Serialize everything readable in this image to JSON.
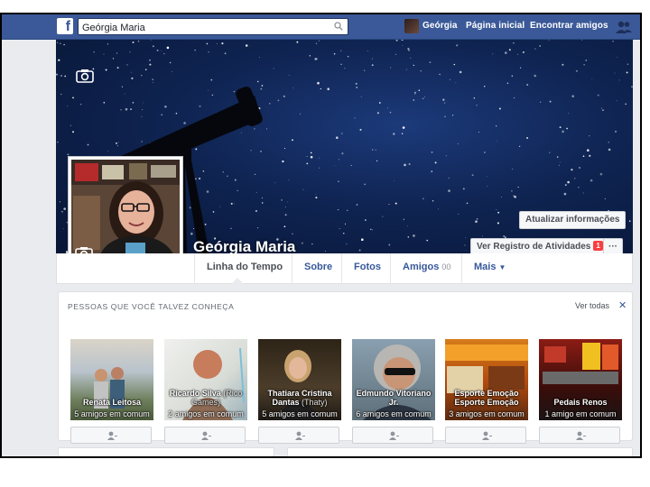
{
  "topbar": {
    "logo": "f",
    "search_value": "Geórgia Maria",
    "user_name": "Geórgia",
    "home_label": "Página inicial",
    "find_friends_label": "Encontrar amigos",
    "icons": [
      "facebook-logo",
      "search-icon",
      "friends-icon"
    ]
  },
  "profile": {
    "name": "Geórgia Maria",
    "update_info_label": "Atualizar informações",
    "activity_log_label": "Ver Registro de Atividades",
    "activity_badge": "1",
    "more_label": "···"
  },
  "tabs": [
    {
      "label": "Linha do Tempo"
    },
    {
      "label": "Sobre"
    },
    {
      "label": "Fotos"
    },
    {
      "label": "Amigos",
      "count": "00"
    },
    {
      "label": "Mais"
    }
  ],
  "pymk": {
    "title": "PESSOAS QUE VOCÊ TALVEZ CONHEÇA",
    "see_all": "Ver todas",
    "close": "✕",
    "people": [
      {
        "name": "Renata Leitosa",
        "alt": "",
        "mutual": "5 amigos em comum"
      },
      {
        "name": "Ricardo Silva",
        "alt": "(Rico Games)",
        "mutual": "2 amigos em comum"
      },
      {
        "name": "Thatiara Cristina Dantas",
        "alt": "(Thaty)",
        "mutual": "5 amigos em comum"
      },
      {
        "name": "Edmundo Vitoriano Jr.",
        "alt": "",
        "mutual": "6 amigos em comum"
      },
      {
        "name": "Esporte Emoção Esporte Emoção",
        "alt": "",
        "mutual": "3 amigos em comum"
      },
      {
        "name": "Pedais Renos",
        "alt": "",
        "mutual": "1 amigo em comum"
      }
    ]
  },
  "colors": {
    "brand_blue": "#3b5998",
    "link_blue": "#365899",
    "background": "#e9ebee",
    "badge_red": "#fa3e3e"
  }
}
